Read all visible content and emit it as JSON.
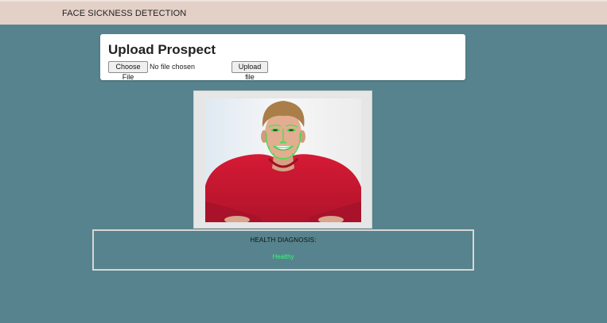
{
  "header": {
    "title": "FACE SICKNESS DETECTION"
  },
  "upload": {
    "heading": "Upload Prospect",
    "choose_label": "Choose File",
    "file_status": "No file chosen",
    "upload_label": "Upload file"
  },
  "diagnosis": {
    "label": "HEALTH DIAGNOSIS:",
    "result": "Healthy",
    "result_color": "#2cff6a"
  },
  "colors": {
    "page_bg": "#56838d",
    "header_bg": "#e3d0c7",
    "landmark_overlay": "#2ee84a"
  }
}
